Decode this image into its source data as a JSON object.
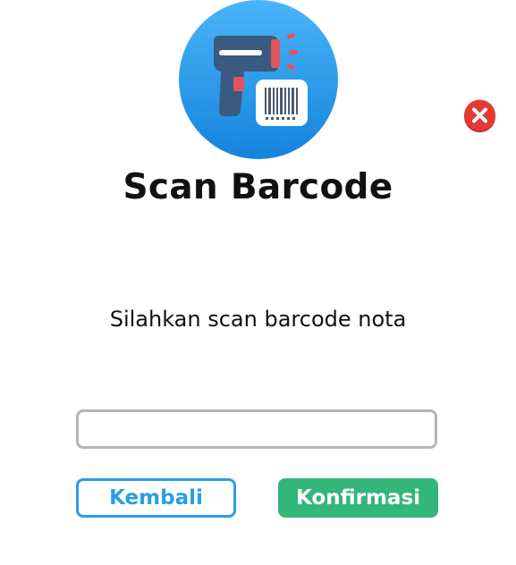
{
  "dialog": {
    "title": "Scan Barcode",
    "instruction": "Silahkan scan barcode nota",
    "input": {
      "value": "",
      "placeholder": ""
    },
    "buttons": {
      "back_label": "Kembali",
      "confirm_label": "Konfirmasi"
    },
    "icons": {
      "hero": "barcode-scanner-icon",
      "close": "close-icon"
    }
  },
  "colors": {
    "hero_circle": "#1e90e8",
    "close_red": "#e53935",
    "back_border": "#2a9de6",
    "confirm_bg": "#33b679",
    "input_border": "#b5b5b5"
  }
}
